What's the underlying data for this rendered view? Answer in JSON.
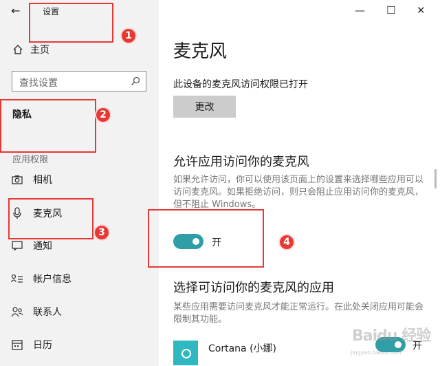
{
  "window": {
    "title": "设置"
  },
  "sidebar": {
    "home_label": "主页",
    "search_placeholder": "查找设置",
    "section_title": "隐私",
    "group_label": "应用权限",
    "items": [
      {
        "label": "相机",
        "icon": "camera-icon"
      },
      {
        "label": "麦克风",
        "icon": "microphone-icon"
      },
      {
        "label": "通知",
        "icon": "notification-icon"
      },
      {
        "label": "帐户信息",
        "icon": "account-info-icon"
      },
      {
        "label": "联系人",
        "icon": "contacts-icon"
      },
      {
        "label": "日历",
        "icon": "calendar-icon"
      }
    ]
  },
  "main": {
    "title": "麦克风",
    "device_status": "此设备的麦克风访问权限已打开",
    "change_button": "更改",
    "allow_heading": "允许应用访问你的麦克风",
    "allow_description": "如果允许访问，你可以使用该页面上的设置来选择哪些应用可以访问麦克风。如果拒绝访问，则只会阻止应用访问你的麦克风，但不阻止 Windows。",
    "toggle_label": "开",
    "choose_heading": "选择可访问你的麦克风的应用",
    "choose_description": "某些应用需要访问麦克风才能正常运行。在此处关闭应用可能会限制其功能。",
    "app_name": "Cortana (小娜)",
    "app_toggle_label": "开"
  },
  "annotations": {
    "b1": "1",
    "b2": "2",
    "b3": "3",
    "b4": "4"
  },
  "watermark": {
    "text": "Baidu 经验",
    "url": "jingyan.baidu.com"
  },
  "colors": {
    "toggle_on": "#2f9ea7",
    "annotation_red": "#e53935",
    "sidebar_bg": "#f2f2f2"
  }
}
